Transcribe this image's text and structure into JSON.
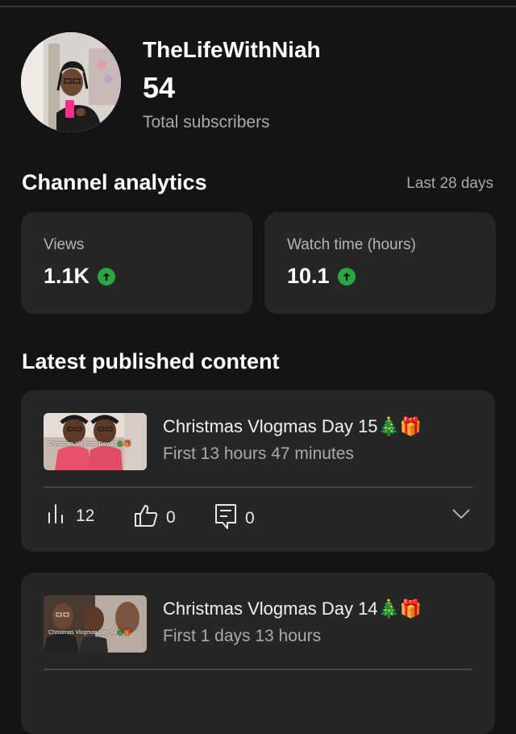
{
  "channel": {
    "name": "TheLifeWithNiah",
    "subscriber_count": "54",
    "subscriber_label": "Total subscribers"
  },
  "analytics": {
    "title": "Channel analytics",
    "period": "Last 28 days",
    "views": {
      "label": "Views",
      "value": "1.1K",
      "trend": "up"
    },
    "watch_time": {
      "label": "Watch time (hours)",
      "value": "10.1",
      "trend": "up"
    },
    "accent_color": "#2ba640"
  },
  "latest": {
    "title": "Latest published content",
    "items": [
      {
        "title": "Christmas Vlogmas Day 15🎄🎁",
        "subtitle": "First 13 hours 47 minutes",
        "thumb_caption": "Christmas Vlogmas Day 15🎄🎁",
        "views": "12",
        "likes": "0",
        "comments": "0"
      },
      {
        "title": "Christmas Vlogmas Day 14🎄🎁",
        "subtitle": "First 1 days 13 hours",
        "thumb_caption": "Christmas Vlogmas Day 14🎄🎁"
      }
    ]
  },
  "icons": {
    "views": "bar-chart-icon",
    "likes": "thumbs-up-icon",
    "comments": "comment-icon",
    "expand": "chevron-down-icon",
    "trend": "arrow-up-icon"
  }
}
